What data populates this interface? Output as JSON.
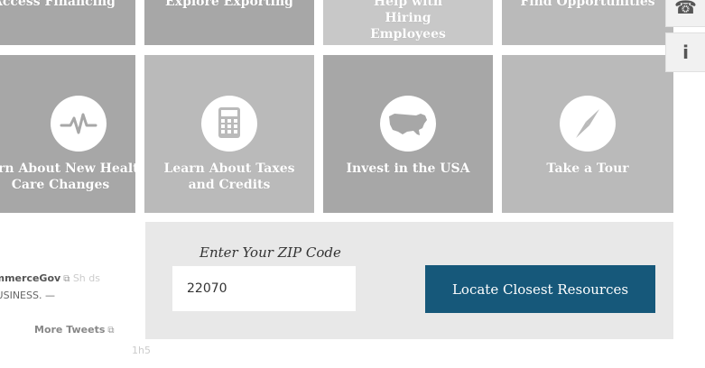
{
  "tiles_top": [
    {
      "label": "Access Financing"
    },
    {
      "label": "Explore Exporting"
    },
    {
      "label": "Help with Hiring Employees"
    },
    {
      "label": "Find Opportunities"
    }
  ],
  "tiles_main": [
    {
      "label": "Learn About New Health Care Changes",
      "icon": "heartbeat-icon"
    },
    {
      "label": "Learn About Taxes and Credits",
      "icon": "calculator-icon"
    },
    {
      "label": "Invest in the USA",
      "icon": "usa-map-icon"
    },
    {
      "label": "Take a Tour",
      "icon": "compass-icon"
    }
  ],
  "side_tabs": {
    "phone": "☎",
    "info": "i"
  },
  "zip": {
    "label": "Enter Your ZIP Code",
    "value": "22070",
    "button": "Locate Closest Resources"
  },
  "tweets": {
    "handle": "@CommerceGov",
    "snippet": "BUSINESS. —",
    "more": "More Tweets",
    "faint": "Sh ds",
    "bottom": "1h5"
  },
  "colors": {
    "tile_dark": "#a7a7a7",
    "tile_light": "#bababa",
    "tile_lighter": "#c8c8c8",
    "button": "#16587a",
    "panel": "#e8e8e8"
  }
}
